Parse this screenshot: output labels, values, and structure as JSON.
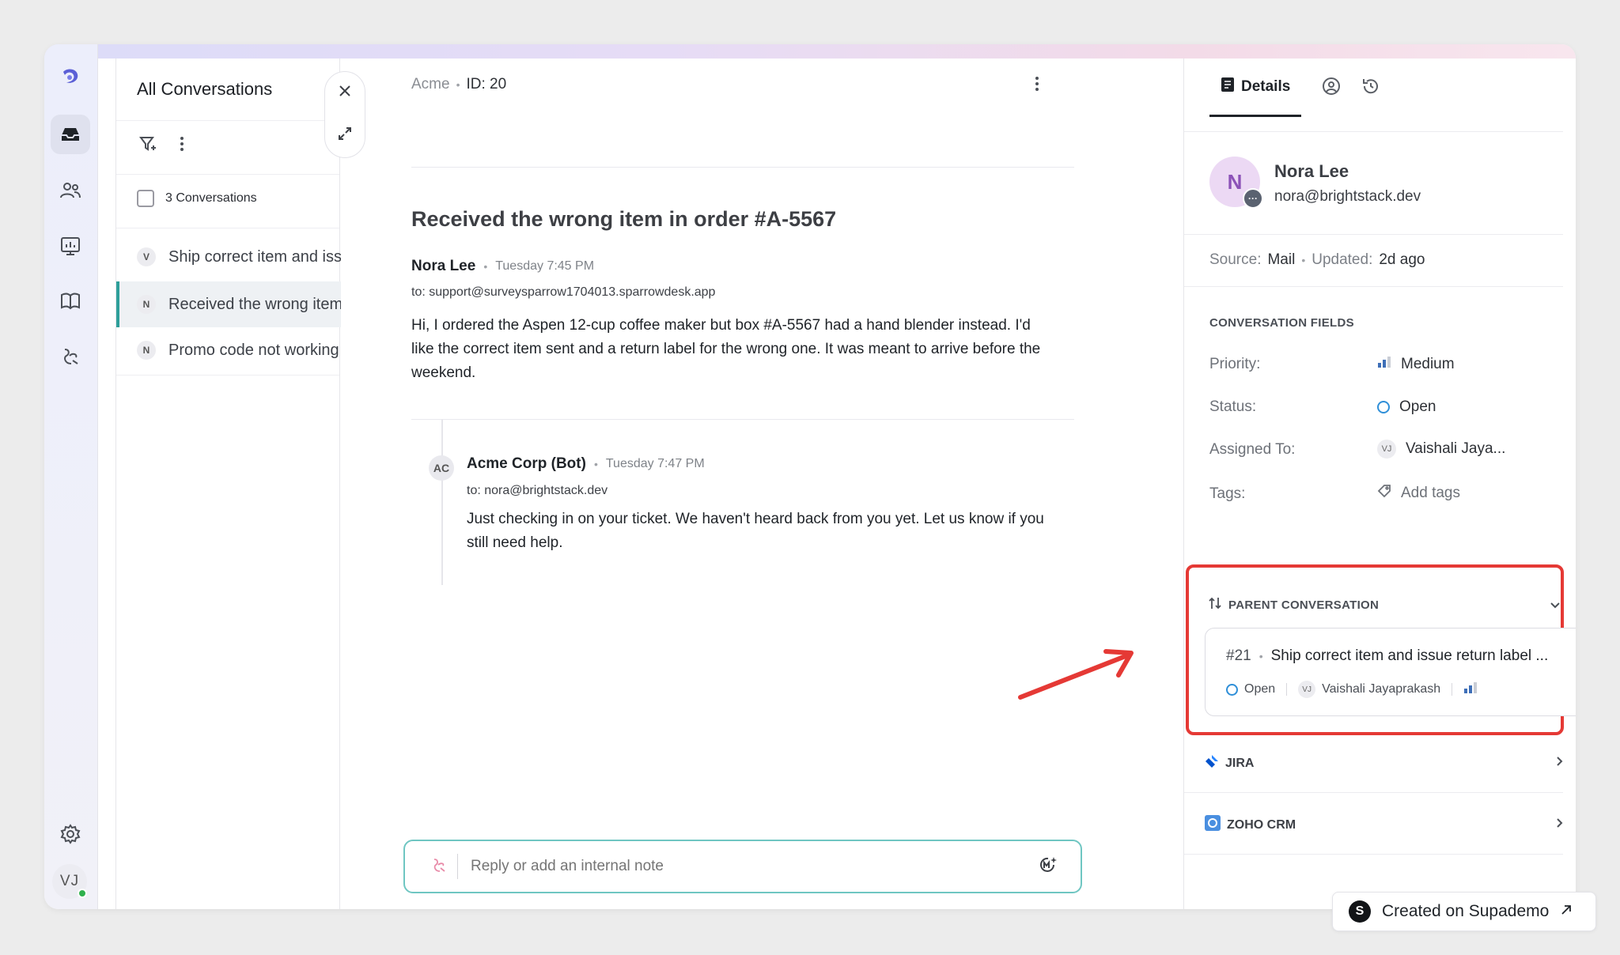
{
  "rail": {
    "items": [
      {
        "name": "logo",
        "active": false
      },
      {
        "name": "inbox",
        "active": true
      },
      {
        "name": "contacts",
        "active": false
      },
      {
        "name": "reports",
        "active": false
      },
      {
        "name": "knowledge-base",
        "active": false
      },
      {
        "name": "automation",
        "active": false
      }
    ],
    "user_initials": "VJ"
  },
  "list": {
    "title": "All Conversations",
    "count_label": "3 Conversations",
    "conversations": [
      {
        "initial": "V",
        "text": "Ship correct item and iss",
        "active": false
      },
      {
        "initial": "N",
        "text": "Received the wrong item",
        "active": true
      },
      {
        "initial": "N",
        "text": "Promo code not working",
        "active": false
      }
    ]
  },
  "center": {
    "org": "Acme",
    "id_label": "ID: 20",
    "subject": "Received the wrong item in order #A-5567",
    "messages": [
      {
        "sender": "Nora Lee",
        "time": "Tuesday 7:45 PM",
        "to": "to: support@surveysparrow1704013.sparrowdesk.app",
        "body": [
          "Hi, I ordered the Aspen 12-cup coffee maker but box #A-5567 had a hand blender instead. I'd",
          "like the correct item sent and a return label for the wrong one. It was meant to arrive before the",
          "weekend."
        ]
      },
      {
        "sender": "Acme Corp (Bot)",
        "avatar": "AC",
        "time": "Tuesday 7:47 PM",
        "to": "to: nora@brightstack.dev",
        "body": [
          "Just checking in on your ticket. We haven't heard back from you yet. Let us know if you",
          "still need help."
        ]
      }
    ],
    "reply_placeholder": "Reply or add an internal note"
  },
  "details": {
    "tab_label": "Details",
    "user": {
      "initial": "N",
      "name": "Nora Lee",
      "email": "nora@brightstack.dev"
    },
    "source_label": "Source:",
    "source_value": "Mail",
    "updated_label": "Updated:",
    "updated_value": "2d ago",
    "fields_title": "CONVERSATION FIELDS",
    "fields": {
      "priority_label": "Priority:",
      "priority_value": "Medium",
      "status_label": "Status:",
      "status_value": "Open",
      "assigned_label": "Assigned To:",
      "assigned_initials": "VJ",
      "assigned_value": "Vaishali Jaya...",
      "tags_label": "Tags:",
      "tags_value": "Add tags"
    },
    "parent": {
      "title": "PARENT CONVERSATION",
      "number": "#21",
      "subject": "Ship correct item and issue return label ...",
      "status": "Open",
      "assignee_initials": "VJ",
      "assignee": "Vaishali Jayaprakash"
    },
    "integrations": [
      {
        "label": "JIRA"
      },
      {
        "label": "ZOHO CRM"
      }
    ]
  },
  "badge": {
    "logo": "S",
    "text": "Created on Supademo"
  },
  "colors": {
    "accent_teal": "#2e9f9a",
    "highlight_red": "#e53935",
    "status_blue": "#2f8fd8"
  }
}
